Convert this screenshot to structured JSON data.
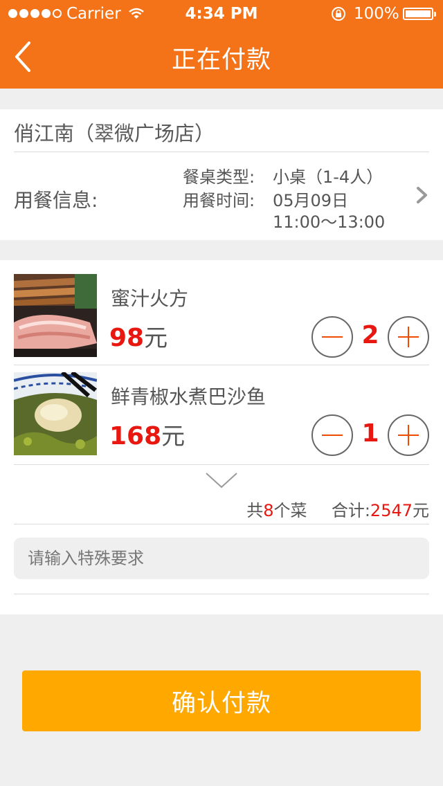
{
  "status_bar": {
    "carrier": "Carrier",
    "time": "4:34 PM",
    "battery": "100%"
  },
  "header": {
    "title": "正在付款"
  },
  "restaurant": {
    "name": "俏江南（翠微广场店）",
    "dining_label": "用餐信息:",
    "table_type_label": "餐桌类型:",
    "table_type_value": "小桌（1-4人）",
    "time_label": "用餐时间:",
    "date_value": "05月09日",
    "time_range_value": "11:00～13:00"
  },
  "dishes": [
    {
      "name": "蜜汁火方",
      "price": "98",
      "unit": "元",
      "quantity": "2"
    },
    {
      "name": "鲜青椒水煮巴沙鱼",
      "price": "168",
      "unit": "元",
      "quantity": "1"
    }
  ],
  "summary": {
    "count_prefix": "共",
    "count": "8",
    "count_suffix": "个菜",
    "total_label": "合计:",
    "total": "2547",
    "total_unit": "元"
  },
  "special_request": {
    "placeholder": "请输入特殊要求",
    "value": ""
  },
  "confirm_label": "确认付款",
  "colors": {
    "header": "#f47318",
    "accent_red": "#e8170f",
    "button": "#ffa800"
  }
}
